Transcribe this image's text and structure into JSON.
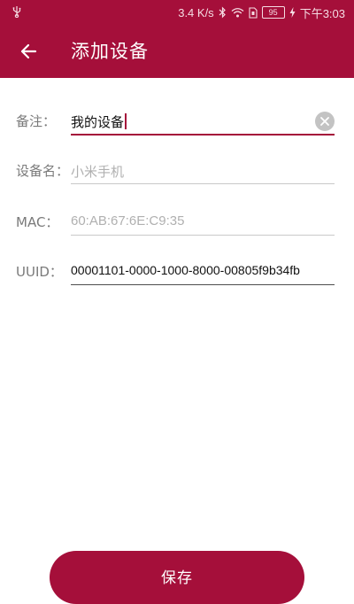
{
  "status_bar": {
    "speed": "3.4 K/s",
    "battery": "95",
    "time": "下午3:03"
  },
  "app_bar": {
    "title": "添加设备"
  },
  "form": {
    "remark": {
      "label": "备注：",
      "value": "我的设备"
    },
    "device_name": {
      "label": "设备名：",
      "placeholder": "小米手机"
    },
    "mac": {
      "label": "MAC：",
      "placeholder": "60:AB:67:6E:C9:35"
    },
    "uuid": {
      "label": "UUID：",
      "value": "00001101-0000-1000-8000-00805f9b34fb"
    }
  },
  "save_button": {
    "label": "保存"
  },
  "colors": {
    "primary": "#a50f3a"
  }
}
